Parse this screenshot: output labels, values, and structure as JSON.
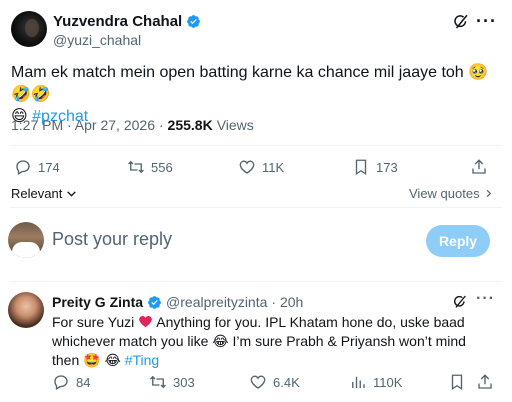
{
  "tweet": {
    "author_name": "Yuzvendra Chahal",
    "author_handle": "@yuzi_chahal",
    "text_main": "Mam ek match mein open batting karne ka chance mil jaaye toh 🥹🤣🤣",
    "text_emoji_line": "😄",
    "hashtag": "#pzchat",
    "timestamp": "1:27 PM · Apr 27, 2026 ·",
    "views_count": "255.8K",
    "views_label": "Views",
    "actions": {
      "replies": "174",
      "reposts": "556",
      "likes": "11K",
      "bookmarks": "173"
    }
  },
  "filters": {
    "sort_label": "Relevant",
    "view_quotes_label": "View quotes"
  },
  "compose": {
    "placeholder": "Post your reply",
    "button_label": "Reply"
  },
  "reply": {
    "author_name": "Preity G Zinta",
    "author_handle": "@realpreityzinta",
    "time": "· 20h",
    "text_part1": "For sure Yuzi",
    "text_part2": "Anything for you. IPL Khatam hone do, uske baad whichever match you like 😂 I’m sure Prabh & Priyansh won’t mind  then 🤩 😂 ",
    "hashtag": "#Ting",
    "actions": {
      "replies": "84",
      "reposts": "303",
      "likes": "6.4K",
      "views": "110K"
    }
  },
  "colors": {
    "accent": "#1d9bf0",
    "reply_button_disabled": "#8ecdf7",
    "heart_red": "#e0245e",
    "muted": "#536471"
  }
}
